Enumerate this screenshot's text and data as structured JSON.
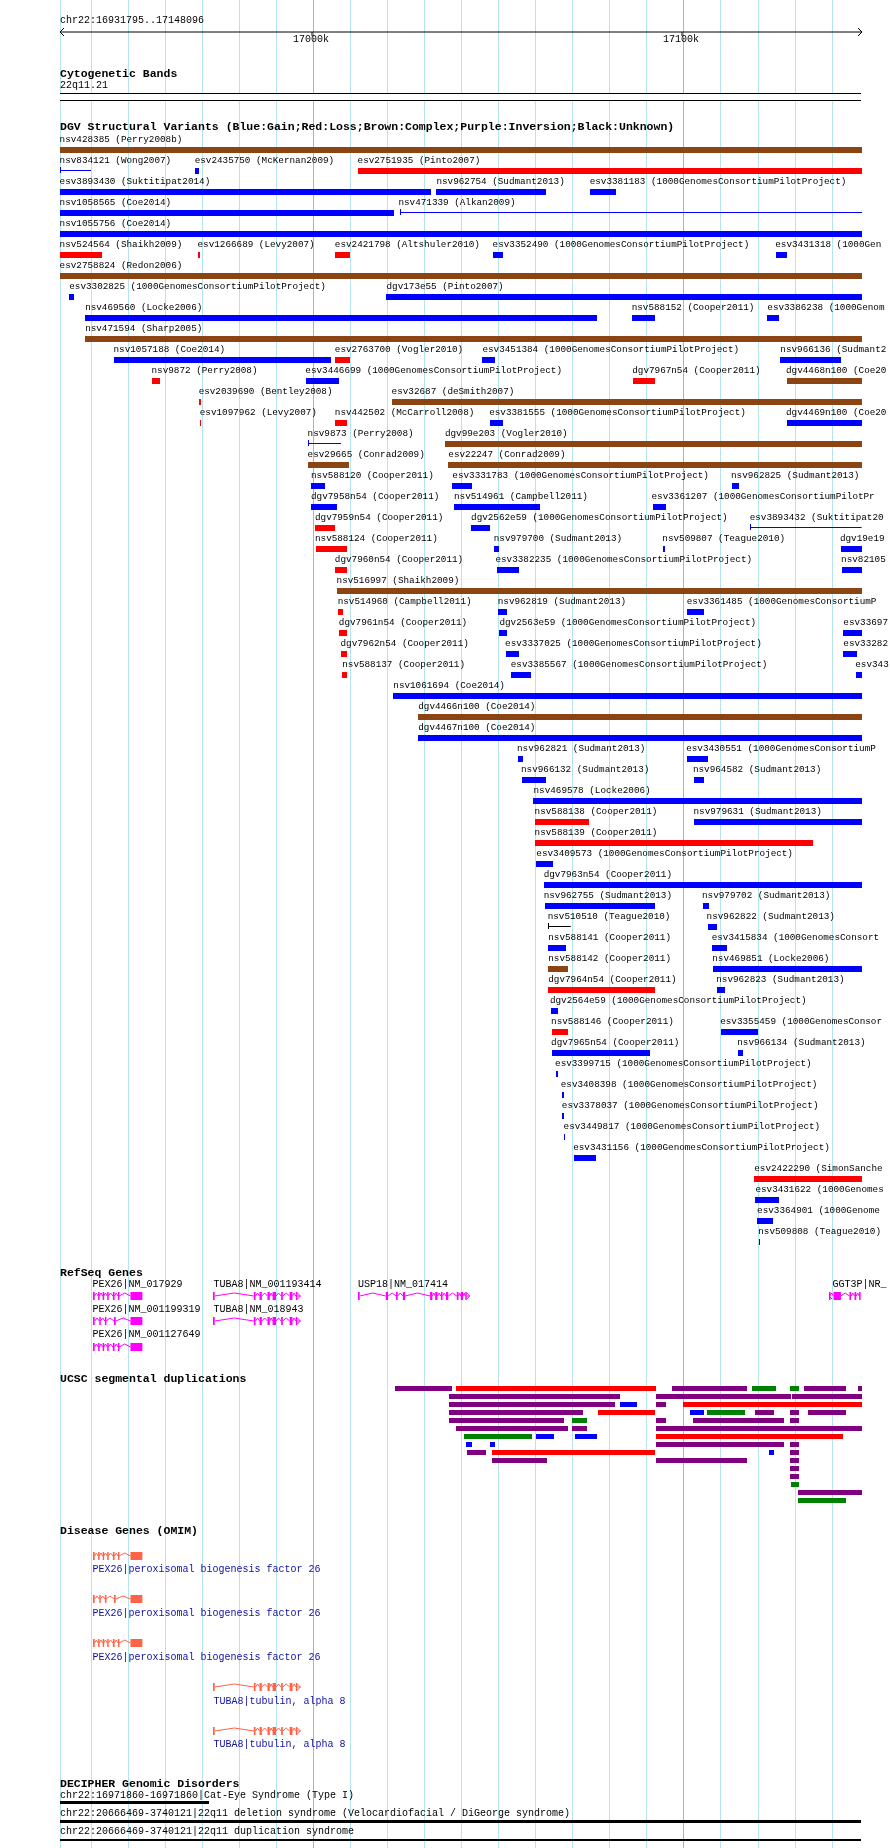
{
  "ruler": {
    "range": "chr22:16931795..17148096",
    "ticks": [
      "17000k",
      "17100k"
    ]
  },
  "cytogenetic_bands": {
    "title": "Cytogenetic Bands",
    "bands": [
      {
        "label": "22q11.21"
      }
    ]
  },
  "dgv": {
    "title": "DGV Structural Variants (Blue:Gain;Red:Loss;Brown:Complex;Purple:Inversion;Black:Unknown)",
    "rows": [
      {
        "items": [
          {
            "label": "nsv428385 (Perry2008b)",
            "color": "#8b4513",
            "kind": "bar"
          }
        ]
      },
      {
        "items": [
          {
            "label": "nsv834121 (Wong2007)",
            "color": "#0000ff",
            "kind": "span"
          },
          {
            "label": "esv2435750 (McKernan2009)",
            "color": "#0000ff",
            "kind": "bar"
          },
          {
            "label": "esv2751935 (Pinto2007)",
            "color": "#ff0000",
            "kind": "bar"
          }
        ]
      },
      {
        "items": [
          {
            "label": "esv3893430 (Suktitipat2014)",
            "color": "#0000ff",
            "kind": "bar"
          },
          {
            "label": "nsv962754 (Sudmant2013)",
            "color": "#0000ff",
            "kind": "bar"
          },
          {
            "label": "esv3381183 (1000GenomesConsortiumPilotProject)",
            "color": "#0000ff",
            "kind": "bar"
          }
        ]
      },
      {
        "items": [
          {
            "label": "nsv1058565 (Coe2014)",
            "color": "#0000ff",
            "kind": "bar"
          },
          {
            "label": "nsv471339 (Alkan2009)",
            "color": "#0000ff",
            "kind": "span"
          }
        ]
      },
      {
        "items": [
          {
            "label": "nsv1055756 (Coe2014)",
            "color": "#0000ff",
            "kind": "bar"
          }
        ]
      },
      {
        "items": [
          {
            "label": "nsv524564 (Shaikh2009)",
            "color": "#ff0000",
            "kind": "bar"
          },
          {
            "label": "esv1266689 (Levy2007)",
            "color": "#ff0000",
            "kind": "bar"
          },
          {
            "label": "esv2421798 (Altshuler2010)",
            "color": "#ff0000",
            "kind": "bar"
          },
          {
            "label": "esv3352490 (1000GenomesConsortiumPilotProject)",
            "color": "#0000ff",
            "kind": "bar"
          },
          {
            "label": "esv3431318 (1000Gen",
            "color": "#0000ff",
            "kind": "bar"
          }
        ]
      },
      {
        "items": [
          {
            "label": "esv2758824 (Redon2006)",
            "color": "#8b4513",
            "kind": "bar"
          }
        ]
      },
      {
        "items": [
          {
            "label": "esv3302825 (1000GenomesConsortiumPilotProject)",
            "color": "#0000ff",
            "kind": "bar"
          },
          {
            "label": "dgv173e55 (Pinto2007)",
            "color": "#0000ff",
            "kind": "bar"
          }
        ]
      },
      {
        "items": [
          {
            "label": "nsv469560 (Locke2006)",
            "color": "#0000ff",
            "kind": "bar"
          },
          {
            "label": "nsv588152 (Cooper2011)",
            "color": "#0000ff",
            "kind": "bar"
          },
          {
            "label": "esv3386238 (1000Genom",
            "color": "#0000ff",
            "kind": "bar"
          }
        ]
      },
      {
        "items": [
          {
            "label": "nsv471594 (Sharp2005)",
            "color": "#8b4513",
            "kind": "bar"
          }
        ]
      },
      {
        "items": [
          {
            "label": "nsv1057188 (Coe2014)",
            "color": "#0000ff",
            "kind": "bar"
          },
          {
            "label": "esv2763700 (Vogler2010)",
            "color": "#ff0000",
            "kind": "bar"
          },
          {
            "label": "esv3451384 (1000GenomesConsortiumPilotProject)",
            "color": "#0000ff",
            "kind": "bar"
          },
          {
            "label": "nsv966136 (Sudmant2",
            "color": "#0000ff",
            "kind": "bar"
          }
        ]
      },
      {
        "items": [
          {
            "label": "nsv9872 (Perry2008)",
            "color": "#ff0000",
            "kind": "bar"
          },
          {
            "label": "esv3446699 (1000GenomesConsortiumPilotProject)",
            "color": "#0000ff",
            "kind": "bar"
          },
          {
            "label": "dgv7967n54 (Cooper2011)",
            "color": "#ff0000",
            "kind": "bar"
          },
          {
            "label": "dgv4468n100 (Coe20",
            "color": "#8b4513",
            "kind": "bar"
          }
        ]
      },
      {
        "items": [
          {
            "label": "esv2039690 (Bentley2008)",
            "color": "#ff0000",
            "kind": "bar"
          },
          {
            "label": "esv32687 (deSmith2007)",
            "color": "#8b4513",
            "kind": "bar"
          }
        ]
      },
      {
        "items": [
          {
            "label": "esv1097962 (Levy2007)",
            "color": "#ff0000",
            "kind": "bar"
          },
          {
            "label": "nsv442502 (McCarroll2008)",
            "color": "#ff0000",
            "kind": "bar"
          },
          {
            "label": "esv3381555 (1000GenomesConsortiumPilotProject)",
            "color": "#0000ff",
            "kind": "bar"
          },
          {
            "label": "dgv4469n100 (Coe20",
            "color": "#0000ff",
            "kind": "bar"
          }
        ]
      },
      {
        "items": [
          {
            "label": "nsv9873 (Perry2008)",
            "color": "#0000ff",
            "kind": "span"
          },
          {
            "label": "dgv99e203 (Vogler2010)",
            "color": "#8b4513",
            "kind": "bar"
          }
        ]
      },
      {
        "items": [
          {
            "label": "esv29665 (Conrad2009)",
            "color": "#8b4513",
            "kind": "bar"
          },
          {
            "label": "esv22247 (Conrad2009)",
            "color": "#8b4513",
            "kind": "bar"
          }
        ]
      },
      {
        "items": [
          {
            "label": "nsv588120 (Cooper2011)",
            "color": "#0000ff",
            "kind": "bar"
          },
          {
            "label": "esv3331783 (1000GenomesConsortiumPilotProject)",
            "color": "#0000ff",
            "kind": "bar"
          },
          {
            "label": "nsv962825 (Sudmant2013)",
            "color": "#0000ff",
            "kind": "bar"
          }
        ]
      },
      {
        "items": [
          {
            "label": "dgv7958n54 (Cooper2011)",
            "color": "#0000ff",
            "kind": "bar"
          },
          {
            "label": "nsv514961 (Campbell2011)",
            "color": "#0000ff",
            "kind": "bar"
          },
          {
            "label": "esv3361207 (1000GenomesConsortiumPilotPr",
            "color": "#0000ff",
            "kind": "bar"
          }
        ]
      },
      {
        "items": [
          {
            "label": "dgv7959n54 (Cooper2011)",
            "color": "#ff0000",
            "kind": "bar"
          },
          {
            "label": "dgv2562e59 (1000GenomesConsortiumPilotProject)",
            "color": "#0000ff",
            "kind": "bar"
          },
          {
            "label": "esv3893432 (Suktitipat20",
            "color": "#0000ff",
            "kind": "span"
          }
        ]
      },
      {
        "items": [
          {
            "label": "nsv588124 (Cooper2011)",
            "color": "#ff0000",
            "kind": "bar"
          },
          {
            "label": "nsv979700 (Sudmant2013)",
            "color": "#0000ff",
            "kind": "bar"
          },
          {
            "label": "nsv509807 (Teague2010)",
            "color": "#0000ff",
            "kind": "bar"
          },
          {
            "label": "dgv19e19",
            "color": "#0000ff",
            "kind": "bar"
          }
        ]
      },
      {
        "items": [
          {
            "label": "dgv7960n54 (Cooper2011)",
            "color": "#ff0000",
            "kind": "bar"
          },
          {
            "label": "esv3382235 (1000GenomesConsortiumPilotProject)",
            "color": "#0000ff",
            "kind": "bar"
          },
          {
            "label": "nsv82105",
            "color": "#0000ff",
            "kind": "bar"
          }
        ]
      },
      {
        "items": [
          {
            "label": "nsv516997 (Shaikh2009)",
            "color": "#8b4513",
            "kind": "bar"
          }
        ]
      },
      {
        "items": [
          {
            "label": "nsv514960 (Campbell2011)",
            "color": "#ff0000",
            "kind": "bar"
          },
          {
            "label": "nsv962819 (Sudmant2013)",
            "color": "#0000ff",
            "kind": "bar"
          },
          {
            "label": "esv3361485 (1000GenomesConsortiumP",
            "color": "#0000ff",
            "kind": "bar"
          }
        ]
      },
      {
        "items": [
          {
            "label": "dgv7961n54 (Cooper2011)",
            "color": "#ff0000",
            "kind": "bar"
          },
          {
            "label": "dgv2563e59 (1000GenomesConsortiumPilotProject)",
            "color": "#0000ff",
            "kind": "bar"
          },
          {
            "label": "esv33697",
            "color": "#0000ff",
            "kind": "bar"
          }
        ]
      },
      {
        "items": [
          {
            "label": "dgv7962n54 (Cooper2011)",
            "color": "#ff0000",
            "kind": "bar"
          },
          {
            "label": "esv3337025 (1000GenomesConsortiumPilotProject)",
            "color": "#0000ff",
            "kind": "bar"
          },
          {
            "label": "esv33282",
            "color": "#0000ff",
            "kind": "bar"
          }
        ]
      },
      {
        "items": [
          {
            "label": "nsv588137 (Cooper2011)",
            "color": "#ff0000",
            "kind": "bar"
          },
          {
            "label": "esv3385567 (1000GenomesConsortiumPilotProject)",
            "color": "#0000ff",
            "kind": "bar"
          },
          {
            "label": "esv343",
            "color": "#0000ff",
            "kind": "bar"
          }
        ]
      },
      {
        "items": [
          {
            "label": "nsv1061694 (Coe2014)",
            "color": "#0000ff",
            "kind": "bar"
          }
        ]
      },
      {
        "items": [
          {
            "label": "dgv4466n100 (Coe2014)",
            "color": "#8b4513",
            "kind": "bar"
          }
        ]
      },
      {
        "items": [
          {
            "label": "dgv4467n100 (Coe2014)",
            "color": "#0000ff",
            "kind": "bar"
          }
        ]
      },
      {
        "items": [
          {
            "label": "nsv962821 (Sudmant2013)",
            "color": "#0000ff",
            "kind": "bar"
          },
          {
            "label": "esv3430551 (1000GenomesConsortiumP",
            "color": "#0000ff",
            "kind": "bar"
          }
        ]
      },
      {
        "items": [
          {
            "label": "nsv966132 (Sudmant2013)",
            "color": "#0000ff",
            "kind": "bar"
          },
          {
            "label": "nsv964582 (Sudmant2013)",
            "color": "#0000ff",
            "kind": "bar"
          }
        ]
      },
      {
        "items": [
          {
            "label": "nsv469578 (Locke2006)",
            "color": "#0000ff",
            "kind": "bar"
          }
        ]
      },
      {
        "items": [
          {
            "label": "nsv588138 (Cooper2011)",
            "color": "#ff0000",
            "kind": "bar"
          },
          {
            "label": "nsv979631 (Sudmant2013)",
            "color": "#0000ff",
            "kind": "bar"
          }
        ]
      },
      {
        "items": [
          {
            "label": "nsv588139 (Cooper2011)",
            "color": "#ff0000",
            "kind": "bar"
          }
        ]
      },
      {
        "items": [
          {
            "label": "esv3409573 (1000GenomesConsortiumPilotProject)",
            "color": "#0000ff",
            "kind": "bar"
          }
        ]
      },
      {
        "items": [
          {
            "label": "dgv7963n54 (Cooper2011)",
            "color": "#0000ff",
            "kind": "bar"
          }
        ]
      },
      {
        "items": [
          {
            "label": "nsv962755 (Sudmant2013)",
            "color": "#0000ff",
            "kind": "bar"
          },
          {
            "label": "nsv979702 (Sudmant2013)",
            "color": "#0000ff",
            "kind": "bar"
          }
        ]
      },
      {
        "items": [
          {
            "label": "nsv510510 (Teague2010)",
            "color": "#000000",
            "kind": "span"
          },
          {
            "label": "nsv962822 (Sudmant2013)",
            "color": "#0000ff",
            "kind": "bar"
          }
        ]
      },
      {
        "items": [
          {
            "label": "nsv588141 (Cooper2011)",
            "color": "#0000ff",
            "kind": "bar"
          },
          {
            "label": "esv3415834 (1000GenomesConsort",
            "color": "#0000ff",
            "kind": "bar"
          }
        ]
      },
      {
        "items": [
          {
            "label": "nsv588142 (Cooper2011)",
            "color": "#8b4513",
            "kind": "bar"
          },
          {
            "label": "nsv469851 (Locke2006)",
            "color": "#0000ff",
            "kind": "bar"
          }
        ]
      },
      {
        "items": [
          {
            "label": "dgv7964n54 (Cooper2011)",
            "color": "#ff0000",
            "kind": "bar"
          },
          {
            "label": "nsv962823 (Sudmant2013)",
            "color": "#0000ff",
            "kind": "bar"
          }
        ]
      },
      {
        "items": [
          {
            "label": "dgv2564e59 (1000GenomesConsortiumPilotProject)",
            "color": "#0000ff",
            "kind": "bar"
          }
        ]
      },
      {
        "items": [
          {
            "label": "nsv588146 (Cooper2011)",
            "color": "#ff0000",
            "kind": "bar"
          },
          {
            "label": "esv3355459 (1000GenomesConsor",
            "color": "#0000ff",
            "kind": "bar"
          }
        ]
      },
      {
        "items": [
          {
            "label": "dgv7965n54 (Cooper2011)",
            "color": "#0000ff",
            "kind": "bar"
          },
          {
            "label": "nsv966134 (Sudmant2013)",
            "color": "#0000ff",
            "kind": "bar"
          }
        ]
      },
      {
        "items": [
          {
            "label": "esv3399715 (1000GenomesConsortiumPilotProject)",
            "color": "#0000ff",
            "kind": "bar"
          }
        ]
      },
      {
        "items": [
          {
            "label": "esv3408398 (1000GenomesConsortiumPilotProject)",
            "color": "#0000ff",
            "kind": "bar"
          }
        ]
      },
      {
        "items": [
          {
            "label": "esv3378037 (1000GenomesConsortiumPilotProject)",
            "color": "#0000ff",
            "kind": "bar"
          }
        ]
      },
      {
        "items": [
          {
            "label": "esv3449817 (1000GenomesConsortiumPilotProject)",
            "color": "#0000ff",
            "kind": "bar"
          }
        ]
      },
      {
        "items": [
          {
            "label": "esv3431156 (1000GenomesConsortiumPilotProject)",
            "color": "#0000ff",
            "kind": "bar"
          }
        ]
      },
      {
        "items": [
          {
            "label": "esv2422290 (SimonSanche",
            "color": "#ff0000",
            "kind": "bar"
          }
        ]
      },
      {
        "items": [
          {
            "label": "esv3431622 (1000Genomes",
            "color": "#0000ff",
            "kind": "bar"
          }
        ]
      },
      {
        "items": [
          {
            "label": "esv3364901 (1000Genome",
            "color": "#0000ff",
            "kind": "bar"
          }
        ]
      },
      {
        "items": [
          {
            "label": "nsv509808 (Teague2010)",
            "color": "#0000ff",
            "kind": "bar"
          }
        ]
      }
    ]
  },
  "refseq_genes": {
    "title": "RefSeq Genes",
    "genes": [
      {
        "label": "PEX26|NM_017929"
      },
      {
        "label": "TUBA8|NM_001193414"
      },
      {
        "label": "USP18|NM_017414"
      },
      {
        "label": "GGT3P|NR_"
      },
      {
        "label": "PEX26|NM_001199319"
      },
      {
        "label": "TUBA8|NM_018943"
      },
      {
        "label": "PEX26|NM_001127649"
      }
    ]
  },
  "segmental_duplications": {
    "title": "UCSC segmental duplications",
    "rows": [
      {
        "bars": [
          {
            "color": "#800080"
          },
          {
            "color": "#ff0000"
          },
          {
            "color": "#800080"
          },
          {
            "color": "#008000"
          },
          {
            "color": "#008000"
          },
          {
            "color": "#800080"
          },
          {
            "color": "#800080"
          }
        ]
      },
      {
        "bars": [
          {
            "color": "#800080"
          },
          {
            "color": "#800080"
          },
          {
            "color": "#800080"
          }
        ]
      },
      {
        "bars": [
          {
            "color": "#800080"
          },
          {
            "color": "#0000ff"
          },
          {
            "color": "#800080"
          },
          {
            "color": "#ff0000"
          }
        ]
      },
      {
        "bars": [
          {
            "color": "#800080"
          },
          {
            "color": "#ff0000"
          },
          {
            "color": "#0000ff"
          },
          {
            "color": "#008000"
          },
          {
            "color": "#800080"
          },
          {
            "color": "#800080"
          },
          {
            "color": "#800080"
          }
        ]
      },
      {
        "bars": [
          {
            "color": "#800080"
          },
          {
            "color": "#008000"
          },
          {
            "color": "#800080"
          },
          {
            "color": "#800080"
          },
          {
            "color": "#800080"
          }
        ]
      },
      {
        "bars": [
          {
            "color": "#800080"
          },
          {
            "color": "#800080"
          },
          {
            "color": "#800080"
          }
        ]
      },
      {
        "bars": [
          {
            "color": "#008000"
          },
          {
            "color": "#0000ff"
          },
          {
            "color": "#0000ff"
          },
          {
            "color": "#ff0000"
          }
        ]
      },
      {
        "bars": [
          {
            "color": "#0000ff"
          },
          {
            "color": "#0000ff"
          },
          {
            "color": "#800080"
          },
          {
            "color": "#800080"
          }
        ]
      },
      {
        "bars": [
          {
            "color": "#800080"
          },
          {
            "color": "#ff0000"
          },
          {
            "color": "#0000ff"
          },
          {
            "color": "#800080"
          }
        ]
      },
      {
        "bars": [
          {
            "color": "#800080"
          },
          {
            "color": "#800080"
          },
          {
            "color": "#800080"
          }
        ]
      },
      {
        "bars": [
          {
            "color": "#800080"
          }
        ]
      },
      {
        "bars": [
          {
            "color": "#800080"
          }
        ]
      },
      {
        "bars": [
          {
            "color": "#008000"
          }
        ]
      },
      {
        "bars": [
          {
            "color": "#800080"
          }
        ]
      },
      {
        "bars": [
          {
            "color": "#008000"
          }
        ]
      }
    ]
  },
  "disease_genes": {
    "title": "Disease Genes (OMIM)",
    "genes": [
      {
        "label": "PEX26|peroxisomal biogenesis factor 26"
      },
      {
        "label": "PEX26|peroxisomal biogenesis factor 26"
      },
      {
        "label": "PEX26|peroxisomal biogenesis factor 26"
      },
      {
        "label": "TUBA8|tubulin, alpha 8"
      },
      {
        "label": "TUBA8|tubulin, alpha 8"
      }
    ]
  },
  "decipher": {
    "title": "DECIPHER Genomic Disorders",
    "disorders": [
      {
        "label": "chr22:16971860-16971860|Cat-Eye Syndrome (Type I)"
      },
      {
        "label": "chr22:20666469-3740121|22q11 deletion syndrome (Velocardiofacial / DiGeorge syndrome)"
      },
      {
        "label": "chr22:20666469-3740121|22q11 duplication syndrome"
      }
    ]
  }
}
